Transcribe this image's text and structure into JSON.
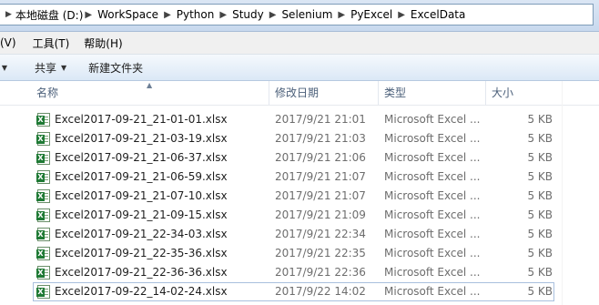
{
  "address_bar": {
    "crumbs": [
      "本地磁盘 (D:)",
      "WorkSpace",
      "Python",
      "Study",
      "Selenium",
      "PyExcel",
      "ExcelData"
    ]
  },
  "menu": {
    "items": [
      "(V)",
      "工具(T)",
      "帮助(H)"
    ]
  },
  "toolbar": {
    "share_label": "共享",
    "new_folder_label": "新建文件夹"
  },
  "columns": {
    "name": "名称",
    "date": "修改日期",
    "type": "类型",
    "size": "大小"
  },
  "files": [
    {
      "name": "Excel2017-09-21_21-01-01.xlsx",
      "date": "2017/9/21 21:01",
      "type": "Microsoft Excel ...",
      "size": "5 KB"
    },
    {
      "name": "Excel2017-09-21_21-03-19.xlsx",
      "date": "2017/9/21 21:03",
      "type": "Microsoft Excel ...",
      "size": "5 KB"
    },
    {
      "name": "Excel2017-09-21_21-06-37.xlsx",
      "date": "2017/9/21 21:06",
      "type": "Microsoft Excel ...",
      "size": "5 KB"
    },
    {
      "name": "Excel2017-09-21_21-06-59.xlsx",
      "date": "2017/9/21 21:07",
      "type": "Microsoft Excel ...",
      "size": "5 KB"
    },
    {
      "name": "Excel2017-09-21_21-07-10.xlsx",
      "date": "2017/9/21 21:07",
      "type": "Microsoft Excel ...",
      "size": "5 KB"
    },
    {
      "name": "Excel2017-09-21_21-09-15.xlsx",
      "date": "2017/9/21 21:09",
      "type": "Microsoft Excel ...",
      "size": "5 KB"
    },
    {
      "name": "Excel2017-09-21_22-34-03.xlsx",
      "date": "2017/9/21 22:34",
      "type": "Microsoft Excel ...",
      "size": "5 KB"
    },
    {
      "name": "Excel2017-09-21_22-35-36.xlsx",
      "date": "2017/9/21 22:35",
      "type": "Microsoft Excel ...",
      "size": "5 KB"
    },
    {
      "name": "Excel2017-09-21_22-36-36.xlsx",
      "date": "2017/9/21 22:36",
      "type": "Microsoft Excel ...",
      "size": "5 KB"
    },
    {
      "name": "Excel2017-09-22_14-02-24.xlsx",
      "date": "2017/9/22 14:02",
      "type": "Microsoft Excel ...",
      "size": "5 KB",
      "selected": true
    }
  ],
  "icons": {
    "file": "excel-file-icon",
    "crumb_separator": "chevron-right-icon"
  }
}
